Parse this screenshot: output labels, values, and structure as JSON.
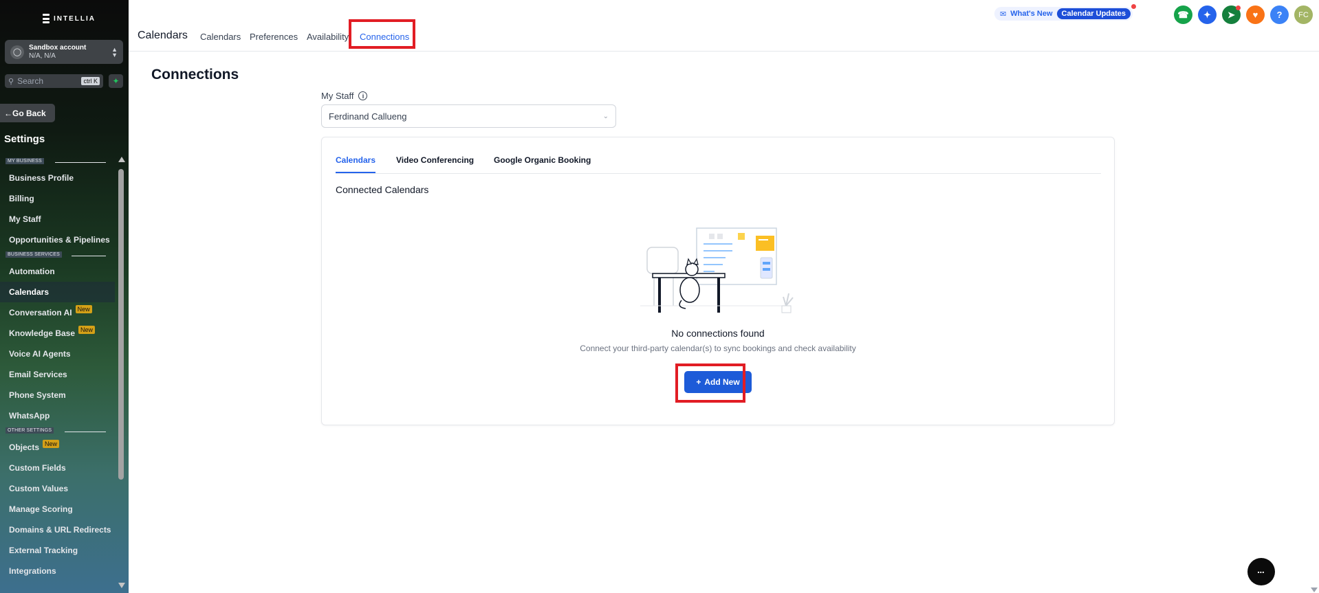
{
  "brand": {
    "name": "INTELLIA"
  },
  "account": {
    "name": "Sandbox account",
    "location": "N/A, N/A"
  },
  "search": {
    "placeholder": "Search",
    "shortcut": "ctrl K"
  },
  "sidebar": {
    "go_back": "Go Back",
    "title": "Settings",
    "sections": [
      {
        "label": "MY BUSINESS",
        "items": [
          {
            "label": "Business Profile"
          },
          {
            "label": "Billing"
          },
          {
            "label": "My Staff"
          },
          {
            "label": "Opportunities & Pipelines"
          }
        ]
      },
      {
        "label": "BUSINESS SERVICES",
        "items": [
          {
            "label": "Automation"
          },
          {
            "label": "Calendars",
            "active": true
          },
          {
            "label": "Conversation AI",
            "badge": "New"
          },
          {
            "label": "Knowledge Base",
            "badge": "New"
          },
          {
            "label": "Voice AI Agents"
          },
          {
            "label": "Email Services"
          },
          {
            "label": "Phone System"
          },
          {
            "label": "WhatsApp"
          }
        ]
      },
      {
        "label": "OTHER SETTINGS",
        "items": [
          {
            "label": "Objects",
            "badge": "New"
          },
          {
            "label": "Custom Fields"
          },
          {
            "label": "Custom Values"
          },
          {
            "label": "Manage Scoring"
          },
          {
            "label": "Domains & URL Redirects"
          },
          {
            "label": "External Tracking"
          },
          {
            "label": "Integrations"
          }
        ]
      }
    ]
  },
  "topbar": {
    "title": "Calendars",
    "tabs": [
      {
        "label": "Calendars"
      },
      {
        "label": "Preferences"
      },
      {
        "label": "Availability"
      },
      {
        "label": "Connections",
        "active": true
      }
    ],
    "whats_new": "What's New",
    "updates_pill": "Calendar Updates",
    "user_initials": "FC"
  },
  "colors": {
    "accent": "#2563eb",
    "highlight": "#e11d24",
    "phone": "#16a34a",
    "magic": "#2563eb",
    "megaphone": "#15803d",
    "bell": "#f97316",
    "help": "#3b82f6",
    "avatar": "#a3b565"
  },
  "main": {
    "title": "Connections",
    "staff_label": "My Staff",
    "staff_value": "Ferdinand Callueng",
    "card_tabs": [
      {
        "label": "Calendars",
        "active": true
      },
      {
        "label": "Video Conferencing"
      },
      {
        "label": "Google Organic Booking"
      }
    ],
    "connected_title": "Connected Calendars",
    "empty_title": "No connections found",
    "empty_subtitle": "Connect your third-party calendar(s) to sync bookings and check availability",
    "add_button": "Add New"
  }
}
